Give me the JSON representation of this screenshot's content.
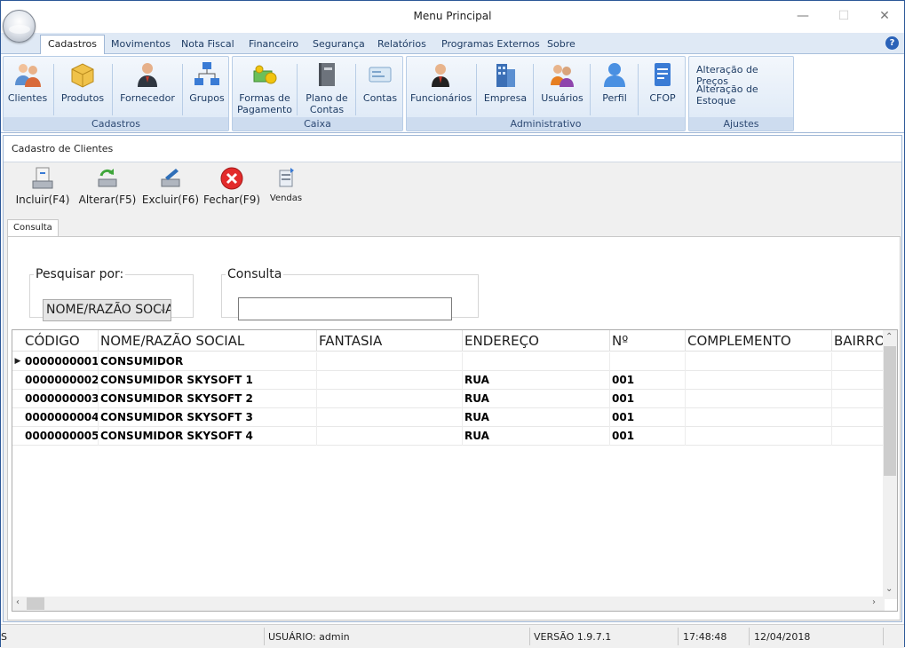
{
  "window": {
    "title": "Menu Principal",
    "minimize": "—",
    "maximize": "☐",
    "close": "✕"
  },
  "tabs": [
    "Cadastros",
    "Movimentos",
    "Nota Fiscal",
    "Financeiro",
    "Segurança",
    "Relatórios",
    "Programas Externos",
    "Sobre"
  ],
  "help": "?",
  "ribbon": {
    "cadastros": {
      "label": "Cadastros",
      "buttons": [
        "Clientes",
        "Produtos",
        "Fornecedor",
        "Grupos"
      ]
    },
    "caixa": {
      "label": "Caixa",
      "buttons": [
        "Formas de Pagamento",
        "Plano de Contas",
        "Contas"
      ]
    },
    "administrativo": {
      "label": "Administrativo",
      "buttons": [
        "Funcionários",
        "Empresa",
        "Usuários",
        "Perfil",
        "CFOP"
      ]
    },
    "ajustes": {
      "label": "Ajustes",
      "links": [
        "Alteração de Preços",
        "Alteração de Estoque"
      ]
    }
  },
  "form": {
    "title": "Cadastro de Clientes",
    "toolbar": [
      "Incluir(F4)",
      "Alterar(F5)",
      "Excluir(F6)",
      "Fechar(F9)",
      "Vendas"
    ],
    "subtab": "Consulta",
    "search_by_legend": "Pesquisar por:",
    "search_by_value": "NOME/RAZÃO SOCIAL",
    "consulta_legend": "Consulta",
    "consulta_value": ""
  },
  "grid": {
    "columns": [
      "CÓDIGO",
      "NOME/RAZÃO SOCIAL",
      "FANTASIA",
      "ENDEREÇO",
      "Nº",
      "COMPLEMENTO",
      "BAIRRO"
    ],
    "rows": [
      [
        "0000000001",
        "CONSUMIDOR",
        "",
        "",
        "",
        "",
        ""
      ],
      [
        "0000000002",
        "CONSUMIDOR SKYSOFT 1",
        "",
        "RUA",
        "001",
        "",
        ""
      ],
      [
        "0000000003",
        "CONSUMIDOR SKYSOFT 2",
        "",
        "RUA",
        "001",
        "",
        ""
      ],
      [
        "0000000004",
        "CONSUMIDOR SKYSOFT 3",
        "",
        "RUA",
        "001",
        "",
        ""
      ],
      [
        "0000000005",
        "CONSUMIDOR SKYSOFT 4",
        "",
        "RUA",
        "001",
        "",
        ""
      ]
    ]
  },
  "status": {
    "left": "S",
    "user": "USUÁRIO: admin",
    "version": "VERSÃO 1.9.7.1",
    "time": "17:48:48",
    "date": "12/04/2018"
  },
  "colors": {
    "accent": "#2b5797",
    "ribbon_bg": "#dce8f6"
  }
}
